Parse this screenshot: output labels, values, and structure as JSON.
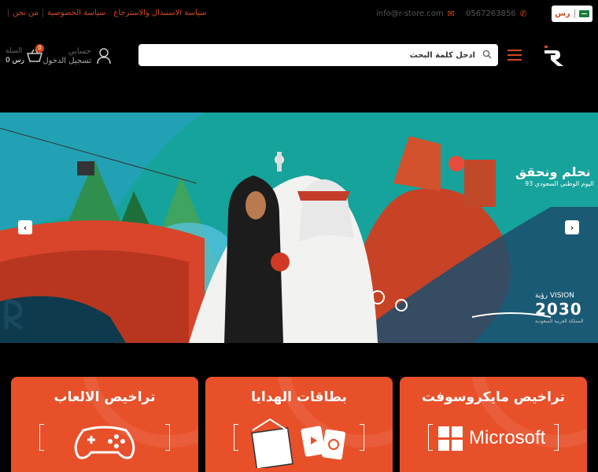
{
  "topbar": {
    "links": [
      "من نحن",
      "سياسة الخصوصية",
      "سياسة الاستبدال والاسترجاع"
    ],
    "email": "info@r-store.com",
    "phone": "0567263856",
    "currency": "رس"
  },
  "header": {
    "search_placeholder": "ادخل كلمة البحث",
    "account_title": "حسابي",
    "account_sub": "تسجيل الدخول",
    "cart_title": "السلة",
    "cart_total": "0 رس",
    "cart_count": "0"
  },
  "banner": {
    "title": "نحلم ونحقق",
    "subtitle": "اليوم الوطني السعودي 93",
    "vision_label": "رؤية VISION",
    "vision_year": "2030",
    "vision_caption": "المملكة العربية السعودية"
  },
  "cards": [
    {
      "title": "تراخيص الالعاب",
      "icon": "gamepad-icon"
    },
    {
      "title": "بطاقات الهدايا",
      "icon": "gift-icon"
    },
    {
      "title": "تراخيص مايكروسوفت",
      "brand": "Microsoft",
      "icon": "microsoft-logo"
    }
  ],
  "colors": {
    "accent": "#d24a1d",
    "card": "#e8502a",
    "banner": "#0f8a8a"
  }
}
